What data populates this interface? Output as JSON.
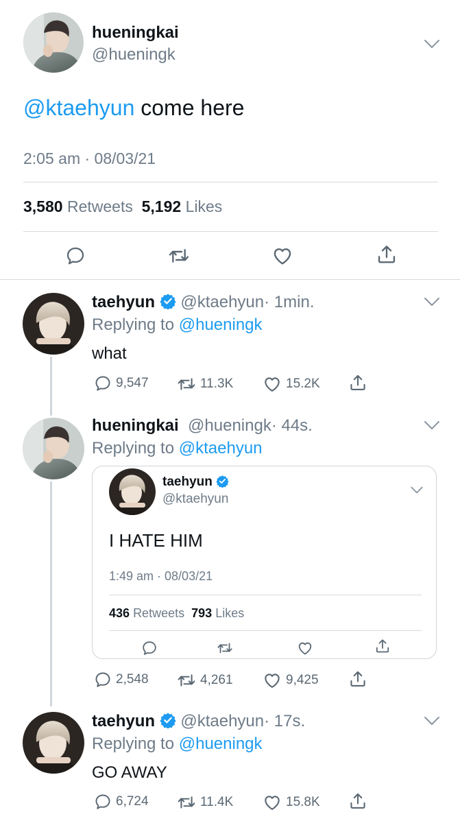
{
  "main_tweet": {
    "display_name": "hueningkai",
    "handle": "@hueningk",
    "mention": "@ktaehyun",
    "text": " come here",
    "timestamp": "2:05 am · 08/03/21",
    "retweets_count": "3,580",
    "retweets_label": "Retweets",
    "likes_count": "5,192",
    "likes_label": "Likes"
  },
  "replies": [
    {
      "display_name": "taehyun",
      "handle": "@ktaehyun",
      "time": "· 1min.",
      "replying_label": "Replying to",
      "replying_to": "@hueningk",
      "text": "what",
      "replies": "9,547",
      "retweets": "11.3K",
      "likes": "15.2K"
    },
    {
      "display_name": "hueningkai",
      "handle": "@hueningk",
      "time": "· 44s.",
      "replying_label": "Replying to",
      "replying_to": "@ktaehyun",
      "quoted": {
        "display_name": "taehyun",
        "handle": "@ktaehyun",
        "text": "I HATE HIM",
        "timestamp": "1:49 am · 08/03/21",
        "retweets_count": "436",
        "retweets_label": "Retweets",
        "likes_count": "793",
        "likes_label": "Likes"
      },
      "replies": "2,548",
      "retweets": "4,261",
      "likes": "9,425"
    },
    {
      "display_name": "taehyun",
      "handle": "@ktaehyun",
      "time": "· 17s.",
      "replying_label": "Replying to",
      "replying_to": "@hueningk",
      "text": "GO AWAY",
      "replies": "6,724",
      "retweets": "11.4K",
      "likes": "15.8K"
    }
  ],
  "colors": {
    "accent": "#1d9bf0",
    "muted": "#6e7b88",
    "divider": "#d6dade",
    "thread_line": "#cfd7de"
  },
  "icons": [
    "reply-icon",
    "retweet-icon",
    "like-icon",
    "share-icon",
    "chevron-down-icon",
    "verified-badge-icon"
  ]
}
